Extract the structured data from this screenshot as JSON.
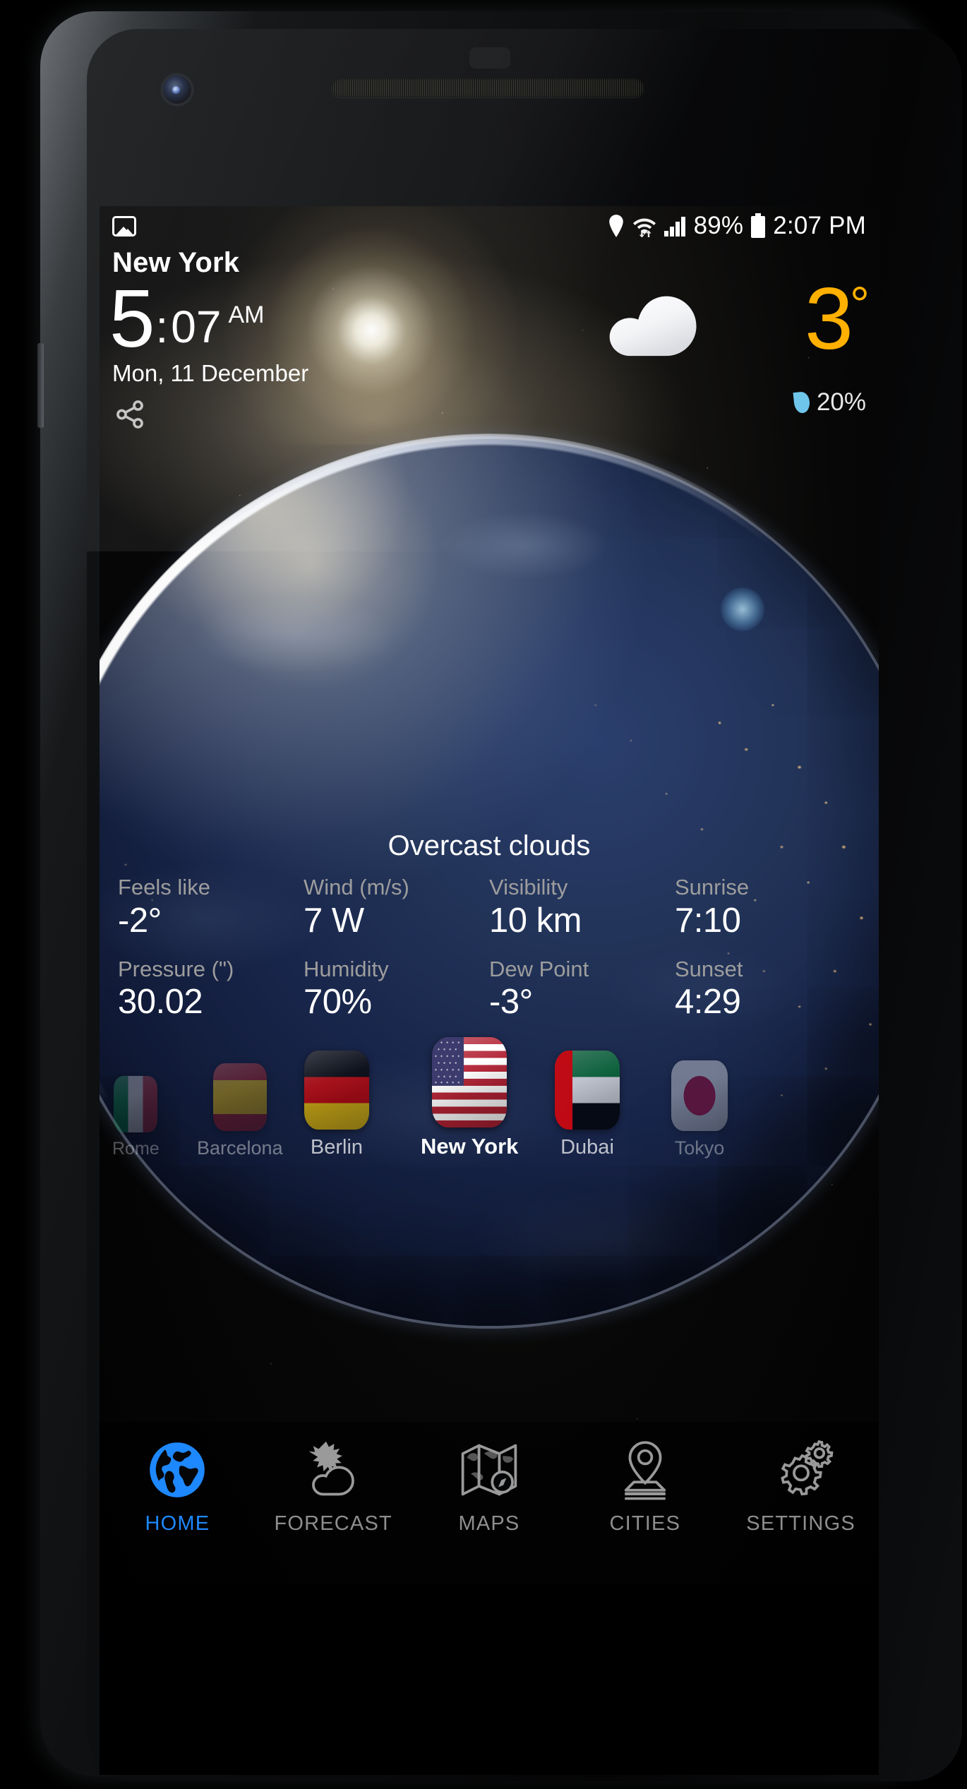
{
  "status_bar": {
    "photo_icon": "photo-icon",
    "location_icon": "location-pin-icon",
    "wifi_icon": "wifi-icon",
    "signal_icon": "cellular-signal-icon",
    "battery_percent": "89%",
    "battery_icon": "battery-icon",
    "clock": "2:07 PM"
  },
  "header": {
    "city": "New York",
    "time_hour": "5",
    "time_colon": ":",
    "time_minute": "07",
    "time_meridiem": "AM",
    "date": "Mon, 11 December",
    "share_icon": "share-icon",
    "weather_icon": "cloud-icon",
    "temperature": "3",
    "degree": "°",
    "precip_icon": "water-drop-icon",
    "precip_value": "20%",
    "accent_temp_color": "#FFB000",
    "accent_drop_color": "#6FC6EB"
  },
  "summary": {
    "condition": "Overcast clouds"
  },
  "stats": [
    {
      "label": "Feels like",
      "value": "-2°"
    },
    {
      "label": "Wind (m/s)",
      "value": "7 W"
    },
    {
      "label": "Visibility",
      "value": "10 km"
    },
    {
      "label": "Sunrise",
      "value": "7:10"
    },
    {
      "label": "Pressure (\")",
      "value": "30.02"
    },
    {
      "label": "Humidity",
      "value": "70%"
    },
    {
      "label": "Dew Point",
      "value": "-3°"
    },
    {
      "label": "Sunset",
      "value": "4:29"
    }
  ],
  "cities": [
    {
      "name": "Rome",
      "flag": "italy-flag-icon",
      "active": false
    },
    {
      "name": "Barcelona",
      "flag": "spain-flag-icon",
      "active": false
    },
    {
      "name": "Berlin",
      "flag": "germany-flag-icon",
      "active": false
    },
    {
      "name": "New York",
      "flag": "usa-flag-icon",
      "active": true
    },
    {
      "name": "Dubai",
      "flag": "uae-flag-icon",
      "active": false
    },
    {
      "name": "Tokyo",
      "flag": "japan-flag-icon",
      "active": false
    }
  ],
  "nav": {
    "active_color": "#1E88FF",
    "inactive_color": "#8E8E8E",
    "items": [
      {
        "label": "HOME",
        "icon": "globe-icon",
        "active": true
      },
      {
        "label": "FORECAST",
        "icon": "sun-cloud-icon",
        "active": false
      },
      {
        "label": "MAPS",
        "icon": "map-icon",
        "active": false
      },
      {
        "label": "CITIES",
        "icon": "location-pin-pedestal-icon",
        "active": false
      },
      {
        "label": "SETTINGS",
        "icon": "gears-icon",
        "active": false
      }
    ]
  }
}
